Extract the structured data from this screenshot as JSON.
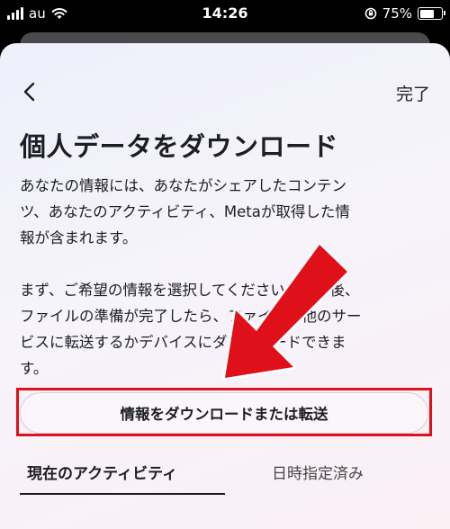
{
  "status_bar": {
    "carrier": "au",
    "time": "14:26",
    "battery_percent": "75%",
    "battery_level": 0.75,
    "icons": [
      "signal-icon",
      "wifi-icon",
      "orientation-lock-icon",
      "battery-icon"
    ]
  },
  "header": {
    "done_label": "完了",
    "back_icon": "chevron-left-icon"
  },
  "page": {
    "title": "個人データをダウンロード",
    "para1_line1": "あなたの情報には、あなたがシェアしたコンテン",
    "para1_line2": "ツ、あなたのアクティビティ、Metaが取得した情",
    "para1_line3": "報が含まれます。",
    "para2_line1": "まず、ご希望の情報を選択してください。その後、",
    "para2_line2": "ファイルの準備が完了したら、ファイルを他のサー",
    "para2_line3": "ビスに転送するかデバイスにダウンロードできま",
    "para2_line4": "す。",
    "download_button_label": "情報をダウンロードまたは転送"
  },
  "tabs": [
    {
      "label": "現在のアクティビティ",
      "selected": true
    },
    {
      "label": "日時指定済み",
      "selected": false
    }
  ],
  "annotation": {
    "highlight_color": "#e0101a",
    "icon": "red-arrow-icon"
  }
}
